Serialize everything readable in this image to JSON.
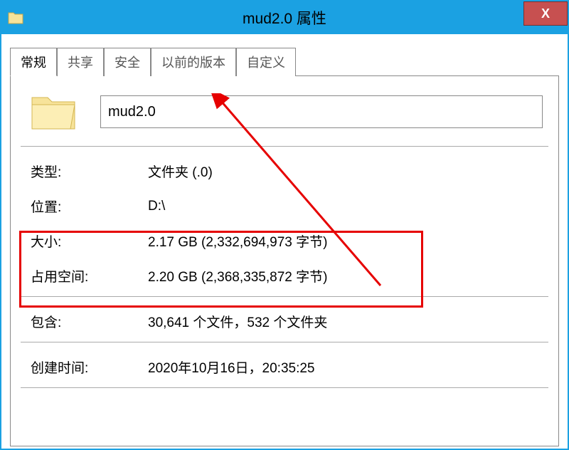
{
  "window": {
    "title": "mud2.0 属性",
    "close": "X"
  },
  "tabs": {
    "general": "常规",
    "sharing": "共享",
    "security": "安全",
    "previous": "以前的版本",
    "custom": "自定义"
  },
  "folder": {
    "name": "mud2.0"
  },
  "props": {
    "type_label": "类型:",
    "type_value": "文件夹 (.0)",
    "location_label": "位置:",
    "location_value": "D:\\",
    "size_label": "大小:",
    "size_value": "2.17 GB (2,332,694,973 字节)",
    "size_on_disk_label": "占用空间:",
    "size_on_disk_value": "2.20 GB (2,368,335,872 字节)",
    "contains_label": "包含:",
    "contains_value": "30,641 个文件，532 个文件夹",
    "created_label": "创建时间:",
    "created_value": "2020年10月16日，20:35:25"
  }
}
